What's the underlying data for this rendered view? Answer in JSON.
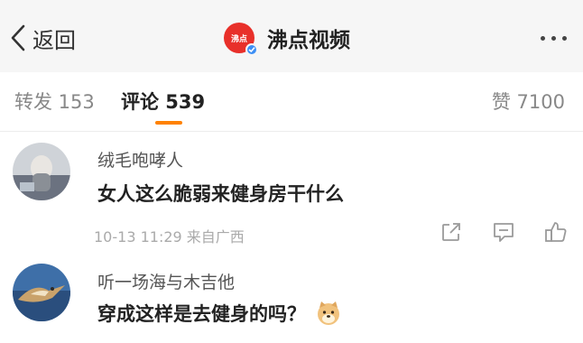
{
  "navbar": {
    "back_label": "返回",
    "title": "沸点视频",
    "logo_text": "沸点",
    "logo_color": "#e8302a",
    "verified_color": "#3d8ff5"
  },
  "tabs": {
    "repost": "转发 153",
    "comment": "评论 539",
    "like": "赞 7100",
    "active": "comment",
    "accent_color": "#ff8200"
  },
  "comments": [
    {
      "username": "绒毛咆哮人",
      "text": "女人这么脆弱来健身房干什么",
      "meta": "10-13 11:29  来自广西",
      "actions": [
        "share-icon",
        "reply-icon",
        "like-icon"
      ]
    },
    {
      "username": "听一场海与木吉他",
      "text": "穿成这样是去健身的吗？",
      "emoji": "doge-emoji"
    }
  ]
}
